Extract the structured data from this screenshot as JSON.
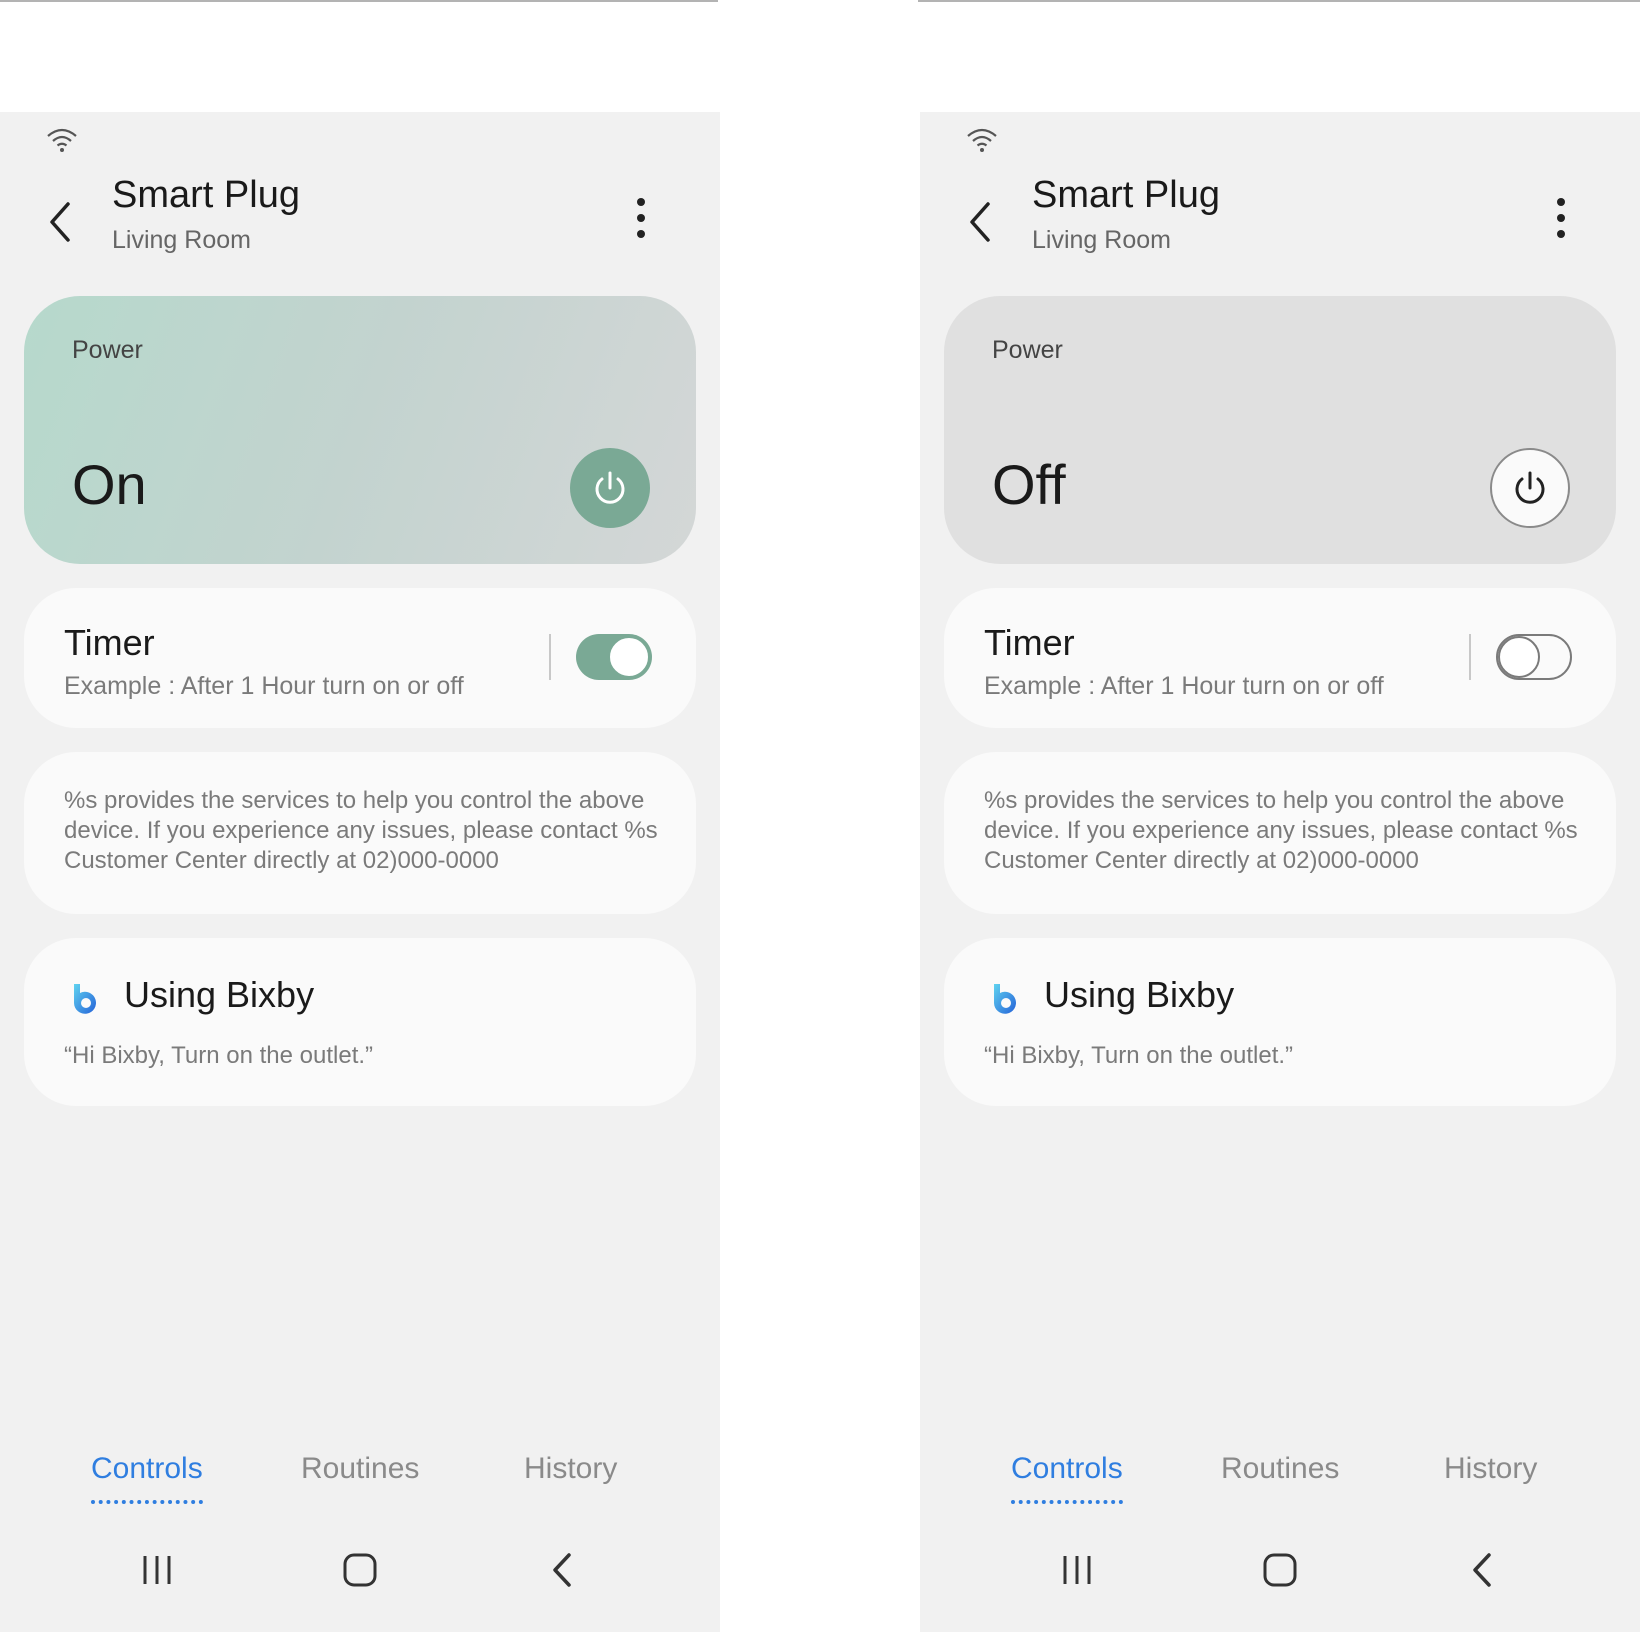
{
  "screens": [
    {
      "id": "on",
      "header": {
        "title": "Smart Plug",
        "subtitle": "Living Room"
      },
      "power": {
        "label": "Power",
        "state": "On"
      },
      "timer": {
        "title": "Timer",
        "description": "Example : After 1 Hour turn on or off",
        "enabled": true
      },
      "info": {
        "text": "%s provides the services to help you control the above device. If you experience any issues, please contact %s Customer Center directly at 02)000-0000"
      },
      "bixby": {
        "title": "Using Bixby",
        "example": "“Hi Bixby, Turn on the outlet.”"
      },
      "tabs": [
        {
          "label": "Controls",
          "active": true
        },
        {
          "label": "Routines",
          "active": false
        },
        {
          "label": "History",
          "active": false
        }
      ]
    },
    {
      "id": "off",
      "header": {
        "title": "Smart Plug",
        "subtitle": "Living Room"
      },
      "power": {
        "label": "Power",
        "state": "Off"
      },
      "timer": {
        "title": "Timer",
        "description": "Example : After 1 Hour turn on or off",
        "enabled": false
      },
      "info": {
        "text": "%s provides the services to help you control the above device. If you experience any issues, please contact %s Customer Center directly at 02)000-0000"
      },
      "bixby": {
        "title": "Using Bixby",
        "example": "“Hi Bixby, Turn on the outlet.”"
      },
      "tabs": [
        {
          "label": "Controls",
          "active": true
        },
        {
          "label": "Routines",
          "active": false
        },
        {
          "label": "History",
          "active": false
        }
      ]
    }
  ],
  "icons": {
    "status": "wifi-icon",
    "back": "back-arrow-icon",
    "more": "more-vertical-icon",
    "power": "power-icon",
    "bixby": "bixby-icon",
    "nav_recents": "recents-icon",
    "nav_home": "home-icon",
    "nav_back": "nav-back-icon"
  },
  "colors": {
    "accent": "#2f7ee0",
    "power_on": "#7aa995",
    "background": "#f1f1f1",
    "card": "#fafafa"
  }
}
